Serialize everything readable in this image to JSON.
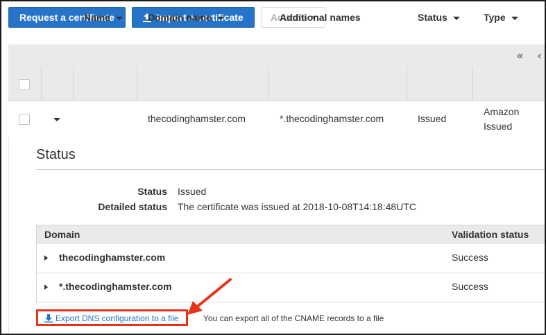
{
  "toolbar": {
    "request_label": "Request a certificate",
    "import_label": "Import a certificate",
    "actions_label": "Actions"
  },
  "pager": {
    "first": "«",
    "prev": "‹"
  },
  "table": {
    "headers": {
      "name": "Name",
      "domain": "Domain name",
      "additional": "Additional names",
      "status": "Status",
      "type": "Type"
    },
    "row": {
      "name": "",
      "domain": "thecodinghamster.com",
      "additional": "*.thecodinghamster.com",
      "status": "Issued",
      "type_line1": "Amazon",
      "type_line2": "Issued"
    }
  },
  "detail": {
    "title": "Status",
    "status_label": "Status",
    "status_value": "Issued",
    "detailed_label": "Detailed status",
    "detailed_value": "The certificate was issued at 2018-10-08T14:18:48UTC",
    "validation": {
      "headers": {
        "domain": "Domain",
        "status": "Validation status"
      },
      "rows": [
        {
          "domain": "thecodinghamster.com",
          "status": "Success"
        },
        {
          "domain": "*.thecodinghamster.com",
          "status": "Success"
        }
      ]
    },
    "export_link": "Export DNS configuration to a file",
    "export_note": "You can export all of the CNAME records to a file"
  },
  "colors": {
    "primary_button": "#2574c9",
    "highlight": "#e8331b",
    "header_bg": "#eaeaea"
  }
}
